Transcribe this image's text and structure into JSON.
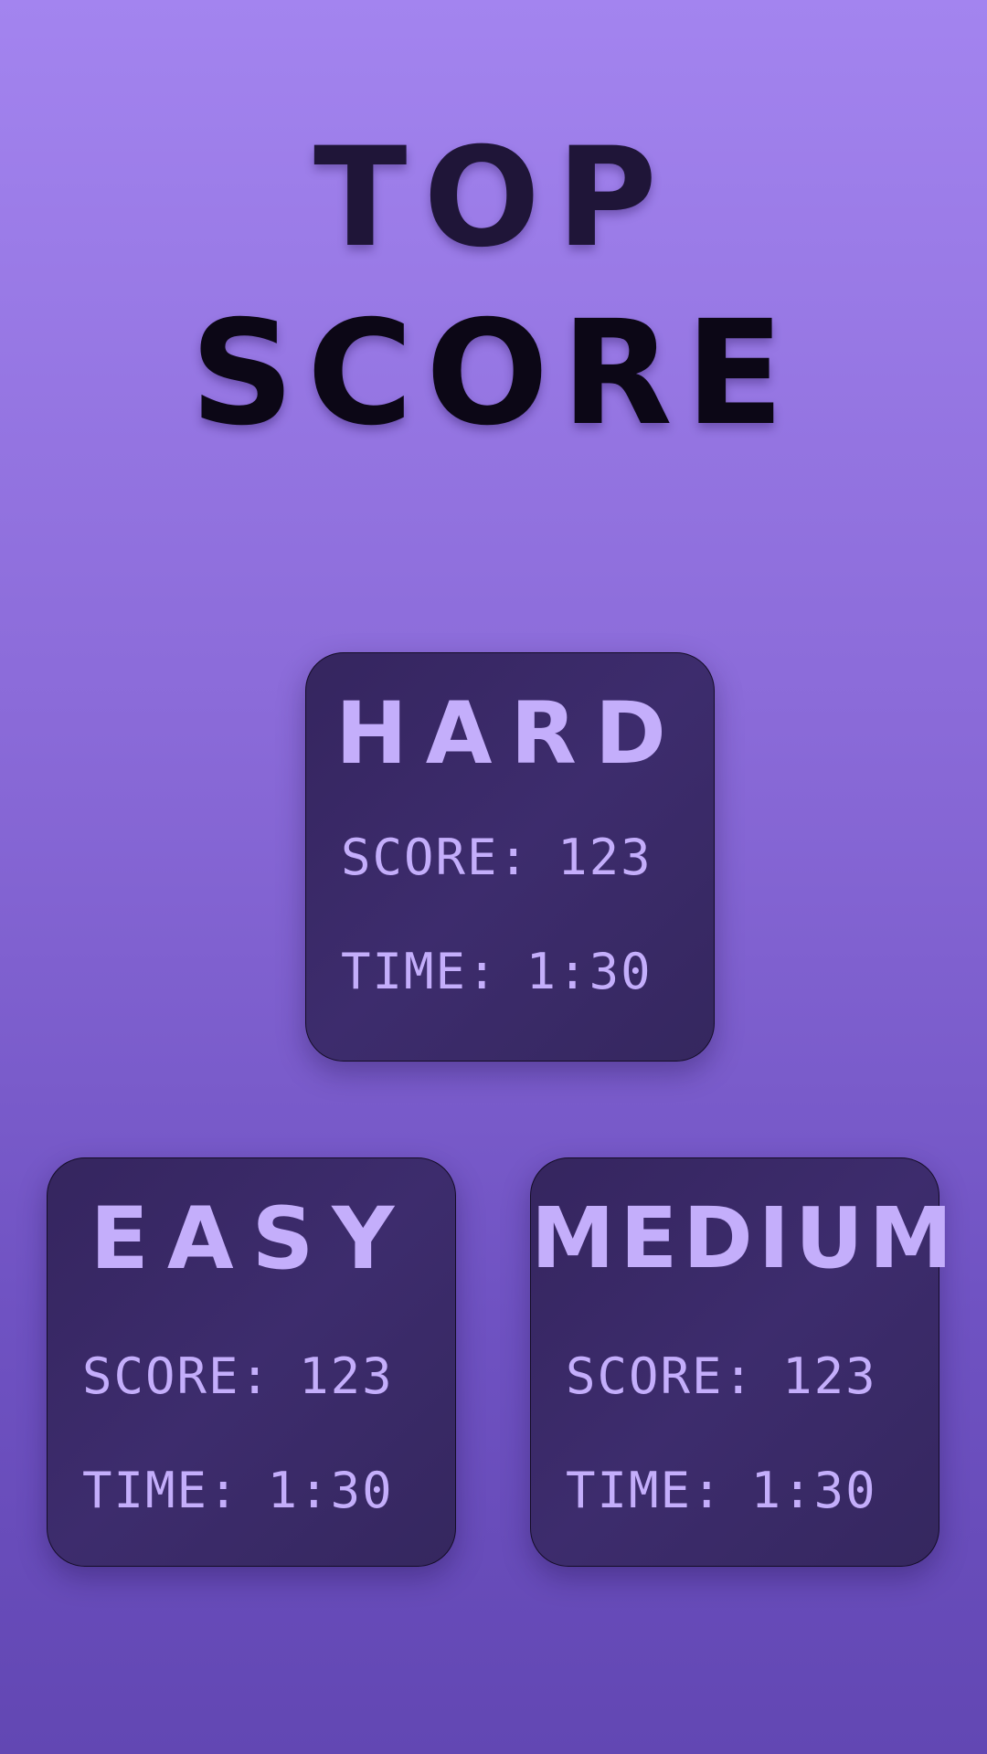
{
  "title": {
    "line1": "TOP",
    "line2": "SCORE"
  },
  "cards": {
    "hard": {
      "title": "HARD",
      "score_label": "SCORE:",
      "score_value": "123",
      "time_label": "TIME:",
      "time_value": "1:30"
    },
    "easy": {
      "title": "EASY",
      "score_label": "SCORE:",
      "score_value": "123",
      "time_label": "TIME:",
      "time_value": "1:30"
    },
    "medium": {
      "title": "MEDIUM",
      "score_label": "SCORE:",
      "score_value": "123",
      "time_label": "TIME:",
      "time_value": "1:30"
    }
  },
  "colors": {
    "background_top": "#a384ef",
    "background_bottom": "#6247b3",
    "card_background": "#3a2a68",
    "card_text": "#c4aefb",
    "title_text": "#0c0716"
  }
}
